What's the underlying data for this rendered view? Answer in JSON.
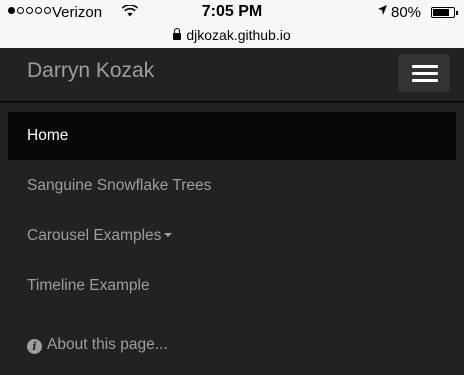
{
  "status_bar": {
    "carrier": "Verizon",
    "time": "7:05 PM",
    "battery_percent": "80%",
    "battery_level": 0.8,
    "icons": [
      "signal-dots",
      "wifi-icon",
      "location-arrow-icon",
      "battery-icon"
    ]
  },
  "url_bar": {
    "url": "djkozak.github.io",
    "icon": "lock-icon"
  },
  "navbar": {
    "brand": "Darryn Kozak",
    "toggle_icon": "hamburger-menu-icon"
  },
  "menu": {
    "items": [
      {
        "label": "Home",
        "active": true
      },
      {
        "label": "Sanguine Snowflake Trees",
        "active": false
      },
      {
        "label": "Carousel Examples",
        "active": false,
        "dropdown": true
      },
      {
        "label": "Timeline Example",
        "active": false
      },
      {
        "label": "About this page...",
        "active": false,
        "icon": "info-circle-icon"
      }
    ]
  },
  "colors": {
    "navbar_bg": "#222222",
    "active_bg": "#080808",
    "link": "#9d9d9d",
    "active_link": "#ffffff"
  }
}
